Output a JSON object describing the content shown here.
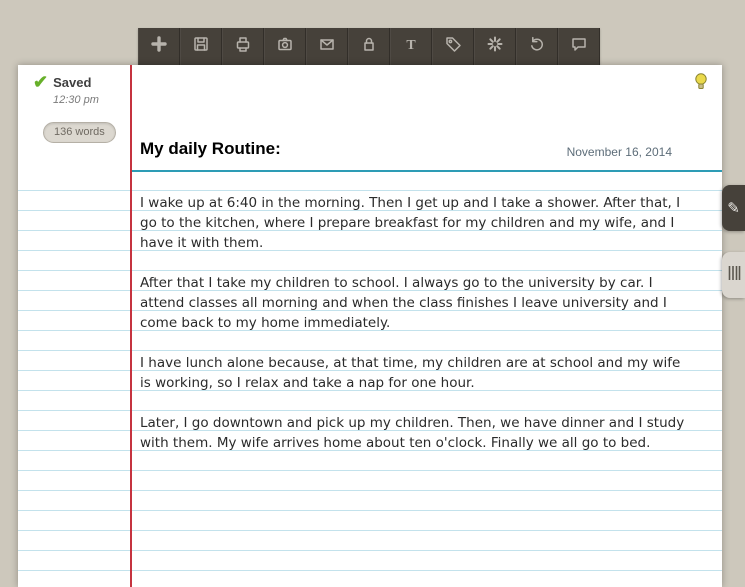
{
  "status": {
    "saved_label": "Saved",
    "saved_time": "12:30 pm",
    "word_count": "136 words"
  },
  "note": {
    "title": "My daily Routine:",
    "date": "November 16, 2014",
    "paragraphs": [
      "I wake up at 6:40 in the morning. Then I get up and I take a shower. After that, I go to the kitchen, where I prepare breakfast for my children and my wife, and I have it with them.",
      "After that I take my children to school. I always go to the university by car. I attend classes all morning and when the class finishes I leave university and I come back to my home immediately.",
      "I have lunch alone because, at that time, my children are at school and my wife is working, so I relax and take a nap for one hour.",
      "Later, I go downtown and pick up my children. Then, we have dinner and I study with them. My wife arrives home about ten o'clock. Finally we all go to bed."
    ]
  },
  "toolbar": {
    "icons": [
      "add-icon",
      "save-icon",
      "print-icon",
      "camera-icon",
      "mail-icon",
      "lock-icon",
      "text-format-icon",
      "tag-icon",
      "loading-icon",
      "undo-icon",
      "comment-icon"
    ]
  },
  "colors": {
    "background": "#cdc8bc",
    "toolbar_bg": "#46413a",
    "rule_line": "#c3e2ec",
    "heavy_rule": "#2d9cb5",
    "margin_line": "#c5333f",
    "saved_green": "#67b02a",
    "paper": "#ffffff"
  }
}
